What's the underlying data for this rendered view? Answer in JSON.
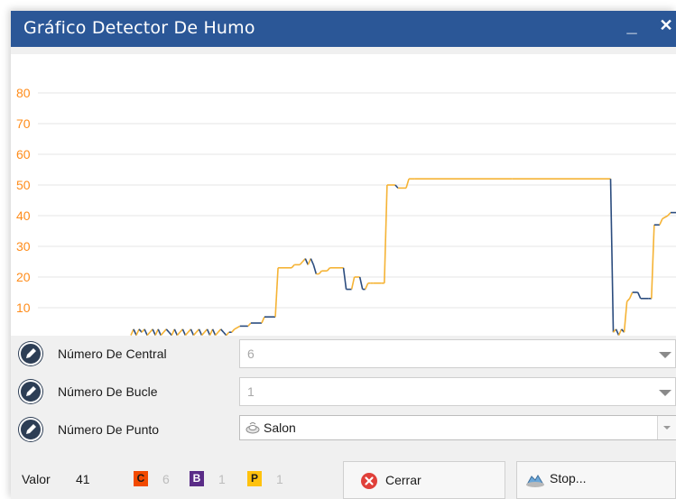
{
  "window": {
    "title": "Gráfico Detector De Humo",
    "minimize_glyph": "_",
    "close_glyph": "✕"
  },
  "chart_data": {
    "type": "line",
    "y_ticks": [
      "80",
      "70",
      "60",
      "50",
      "40",
      "30",
      "20",
      "10"
    ],
    "ylim": [
      0,
      85
    ],
    "grid": true,
    "colors": {
      "normal": "#2b4c7e",
      "rising": "#f5b335",
      "tick_labels": "#ff8c1a"
    },
    "series": [
      {
        "points": [
          [
            0,
            1
          ],
          [
            1,
            3
          ],
          [
            2,
            1
          ],
          [
            3,
            3
          ],
          [
            4,
            2
          ],
          [
            5,
            3
          ],
          [
            6,
            1
          ],
          [
            7,
            2
          ],
          [
            8,
            3
          ],
          [
            9,
            1
          ],
          [
            10,
            3
          ],
          [
            11,
            1
          ],
          [
            12,
            2
          ],
          [
            13,
            3
          ],
          [
            14,
            2
          ],
          [
            15,
            1
          ],
          [
            16,
            3
          ],
          [
            17,
            1
          ],
          [
            18,
            2
          ],
          [
            19,
            3
          ],
          [
            20,
            1
          ],
          [
            21,
            2
          ],
          [
            22,
            3
          ],
          [
            23,
            1
          ],
          [
            24,
            2
          ],
          [
            25,
            3
          ],
          [
            26,
            1
          ],
          [
            27,
            2
          ],
          [
            28,
            3
          ],
          [
            29,
            1
          ],
          [
            30,
            3
          ],
          [
            31,
            1
          ],
          [
            32,
            2
          ],
          [
            33,
            3
          ],
          [
            34,
            2
          ],
          [
            35,
            1
          ],
          [
            36,
            2
          ],
          [
            37,
            2
          ],
          [
            38,
            3
          ],
          [
            40,
            4
          ],
          [
            43,
            4
          ],
          [
            44,
            5
          ],
          [
            48,
            5
          ],
          [
            49,
            7
          ],
          [
            53,
            7
          ],
          [
            54,
            23
          ],
          [
            59,
            23
          ],
          [
            60,
            24
          ],
          [
            62,
            24
          ],
          [
            63,
            25
          ],
          [
            64,
            26
          ],
          [
            65,
            24
          ],
          [
            66,
            26
          ],
          [
            67,
            24
          ],
          [
            68,
            21
          ],
          [
            69,
            21
          ],
          [
            70,
            22
          ],
          [
            72,
            22
          ],
          [
            73,
            23
          ],
          [
            78,
            23
          ],
          [
            79,
            16
          ],
          [
            81,
            16
          ],
          [
            82,
            20
          ],
          [
            84,
            20
          ],
          [
            85,
            16
          ],
          [
            86,
            16
          ],
          [
            87,
            18
          ],
          [
            88,
            18
          ],
          [
            89,
            18
          ],
          [
            92,
            18
          ],
          [
            93,
            18
          ],
          [
            94,
            50
          ],
          [
            97,
            50
          ],
          [
            98,
            49
          ],
          [
            101,
            49
          ],
          [
            102,
            52
          ],
          [
            104,
            52
          ],
          [
            140,
            52
          ],
          [
            176,
            52
          ],
          [
            177,
            2
          ],
          [
            178,
            3
          ],
          [
            179,
            1
          ],
          [
            180,
            3
          ],
          [
            181,
            2
          ],
          [
            182,
            12
          ],
          [
            183,
            13
          ],
          [
            184,
            15
          ],
          [
            186,
            15
          ],
          [
            187,
            13
          ],
          [
            190,
            13
          ],
          [
            191,
            13
          ],
          [
            192,
            37
          ],
          [
            194,
            37
          ],
          [
            195,
            39
          ],
          [
            197,
            40
          ],
          [
            198,
            41
          ],
          [
            200,
            41
          ]
        ]
      }
    ]
  },
  "form": {
    "central": {
      "label": "Número De Central",
      "value": "6"
    },
    "bucle": {
      "label": "Número De Bucle",
      "value": "1"
    },
    "punto": {
      "label": "Número De Punto",
      "value": "Salon"
    }
  },
  "status": {
    "valor_label": "Valor",
    "valor_value": "41",
    "badges": [
      {
        "letter": "C",
        "count": "6",
        "bg": "#f24a00",
        "fg": "#1a1a1a"
      },
      {
        "letter": "B",
        "count": "1",
        "bg": "#5a2c87",
        "fg": "#ffffff"
      },
      {
        "letter": "P",
        "count": "1",
        "bg": "#ffc20e",
        "fg": "#1a1a1a"
      }
    ]
  },
  "buttons": {
    "cerrar": "Cerrar",
    "stop": "Stop..."
  },
  "icons": {
    "edit": "pencil-icon",
    "close_circle": "close-circle-icon",
    "stop": "stop-icon",
    "detector": "smoke-detector-icon"
  }
}
